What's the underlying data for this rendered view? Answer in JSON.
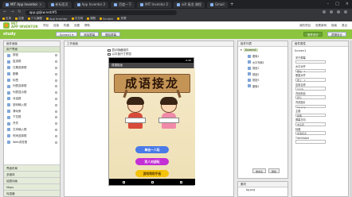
{
  "browser": {
    "tabs": [
      "MIT App Inventor",
      "新标签页",
      "App Inventor 2",
      "百度一下",
      "MIT Inventor 2",
      "aiX 接龙 课程",
      "Gmail"
    ],
    "url": "app.gzjkw.net/#5",
    "bookmarks": [
      "应用",
      "百度",
      "少儿编程",
      "App Inventor",
      "中文网",
      "课程",
      "Scratch",
      "资源"
    ]
  },
  "appinventor": {
    "menus": [
      "项目",
      "连接",
      "构建",
      "设置",
      "帮助"
    ],
    "right_links": [
      "我的项目",
      "查看案例",
      "指南",
      "退出"
    ],
    "project_name": "study",
    "project_buttons": [
      "Screen1 ▾",
      "添加屏幕",
      "删除屏幕"
    ],
    "mode_buttons": [
      "组件设计",
      "逻辑设计"
    ]
  },
  "palette": {
    "title": "组件面板",
    "category": "用户界面",
    "items": [
      "按钮",
      "复选框",
      "日期选择框",
      "图像",
      "标签",
      "列表选择框",
      "列表显示框",
      "对话框",
      "密码输入框",
      "滑动条",
      "下拉框",
      "开关",
      "文本输入框",
      "时间选择框",
      "Web浏览框"
    ],
    "categories": [
      "界面布局",
      "多媒体",
      "绘图动画",
      "Maps",
      "传感器"
    ]
  },
  "viewer": {
    "title": "工作面板",
    "options": [
      "显示隐藏组件",
      "以平板尺寸预览"
    ],
    "screen_title": "成语接龙",
    "status_time": "9:48",
    "banner_text": "成语接龙",
    "buttons": [
      "单击一人玩",
      "双人对战玩",
      "游戏帮助平板"
    ]
  },
  "components": {
    "title": "组件列表",
    "root": "Screen1",
    "items": [
      "图像1",
      "水平布局1",
      "按钮1",
      "按钮2",
      "按钮3",
      "图像2"
    ],
    "rename": "重命名",
    "delete": "删除"
  },
  "media": {
    "title": "素材",
    "files": [
      "bg.png"
    ]
  },
  "properties": {
    "title": "组件属性",
    "screen": "Screen1",
    "items": [
      {
        "label": "关于屏幕",
        "value": ""
      },
      {
        "label": "水平对齐",
        "value": "居左 : 1"
      },
      {
        "label": "垂直对齐",
        "value": "居上 : 1"
      },
      {
        "label": "应用名称",
        "value": "study"
      },
      {
        "label": "背景颜色",
        "value": "默认"
      },
      {
        "label": "背景图片",
        "value": "bg.png"
      },
      {
        "label": "主题",
        "value": "经典"
      },
      {
        "label": "屏幕方向",
        "value": "未设置"
      },
      {
        "label": "标题",
        "value": "成语接龙"
      },
      {
        "label": "TitleVisible",
        "value": ""
      }
    ]
  }
}
